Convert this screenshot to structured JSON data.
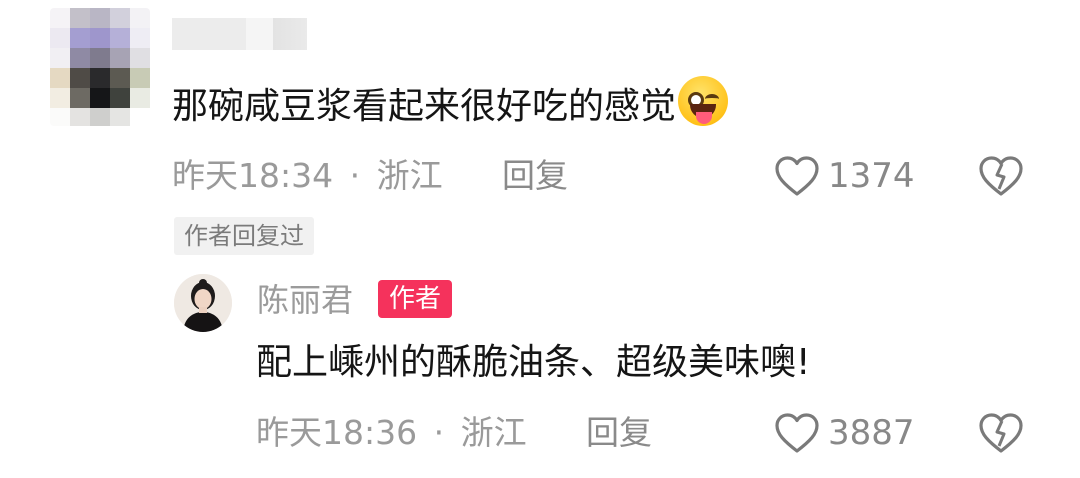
{
  "comment": {
    "text": "那碗咸豆浆看起来很好吃的感觉",
    "emoji": "squinting-face-with-tongue",
    "time": "昨天18:34",
    "separator": "·",
    "location": "浙江",
    "reply_label": "回复",
    "like_count": "1374"
  },
  "author_replied_tag": "作者回复过",
  "reply": {
    "author_name": "陈丽君",
    "author_badge": "作者",
    "text": "配上嵊州的酥脆油条、超级美味噢!",
    "time": "昨天18:36",
    "separator": "·",
    "location": "浙江",
    "reply_label": "回复",
    "like_count": "3887"
  },
  "colors": {
    "text_primary": "#151515",
    "text_secondary": "#9a9a9a",
    "badge_red": "#f5325c",
    "tag_bg": "#f1f1f1"
  },
  "icons": [
    "heart-icon",
    "broken-heart-icon",
    "blurred-avatar",
    "author-avatar"
  ]
}
